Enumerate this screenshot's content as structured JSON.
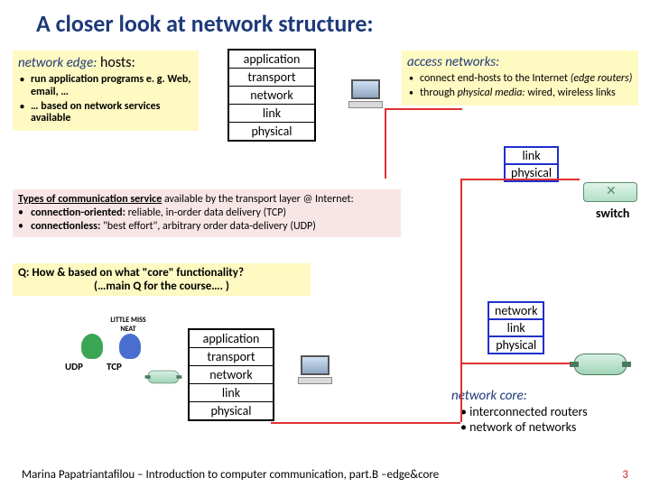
{
  "title": "A closer look at network structure:",
  "edge": {
    "header_ital": "network edge:",
    "header_rest": " hosts:",
    "b1": "run application programs e. g. Web, email, …",
    "b2": "… based on network services available"
  },
  "access": {
    "header": "access networks:",
    "b1_pre": "connect end-hosts to the Internet ",
    "b1_em": "(edge routers)",
    "b2_pre": "through ",
    "b2_em": "physical media: ",
    "b2_post": "wired, wireless links"
  },
  "stack_top": {
    "s1": "application",
    "s2": "transport",
    "s3": "network",
    "s4": "link",
    "s5": "physical"
  },
  "stack_bot": {
    "s1": "application",
    "s2": "transport",
    "s3": "network",
    "s4": "link",
    "s5": "physical"
  },
  "mini_right1": {
    "s1": "link",
    "s2": "physical"
  },
  "mini_right2": {
    "s1": "network",
    "s2": "link",
    "s3": "physical"
  },
  "switch_label": "switch",
  "types": {
    "t1": "Types of communication service",
    "t1_rest": " available by the transport layer @ Internet:",
    "b1a": "connection-oriented:",
    "b1b": " reliable, in-order data delivery (TCP)",
    "b2a": "connectionless:",
    "b2b": " \"best effort\", arbitrary order data-delivery (UDP)"
  },
  "q": {
    "l1": "Q: How & based on what \"core\" functionality?",
    "l2": "(…main Q for the course…. )"
  },
  "chars": {
    "udp": "UDP",
    "tcp": "TCP",
    "little": "LITTLE MISS NEAT"
  },
  "core": {
    "header": "network core:",
    "b1": "interconnected routers",
    "b2": "network of networks"
  },
  "footer": {
    "text": "Marina Papatriantafilou – Introduction to computer communication, part.B –edge&core",
    "page": "3"
  }
}
